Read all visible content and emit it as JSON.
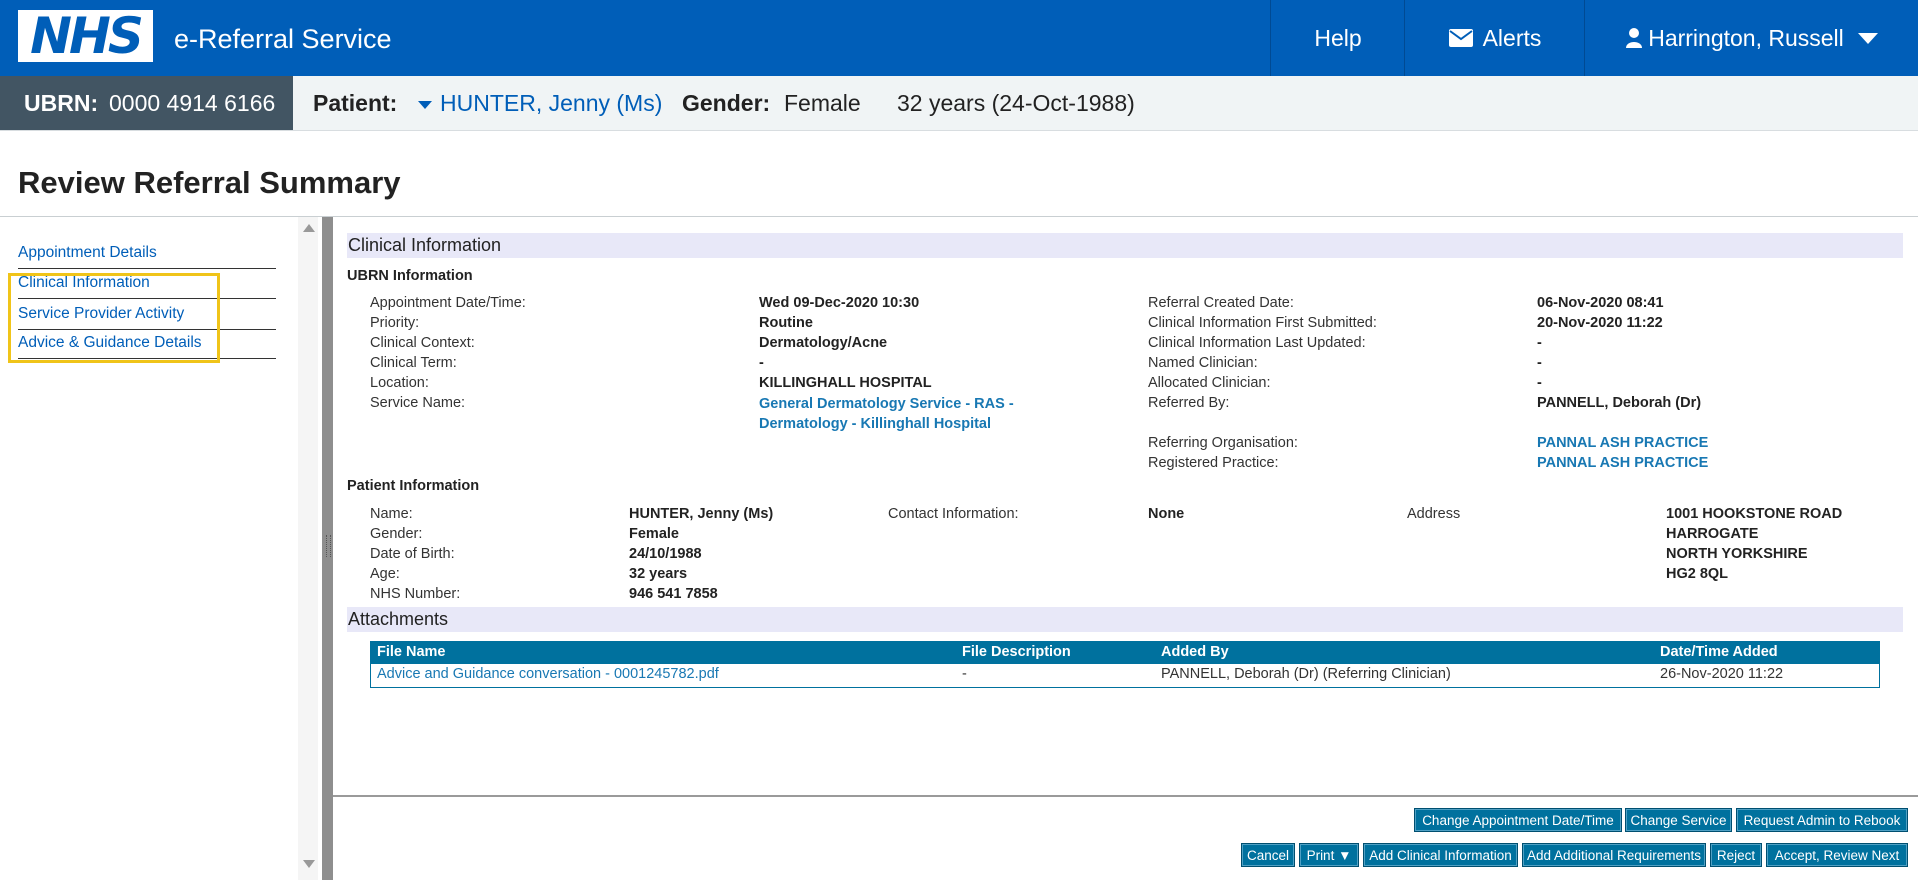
{
  "header": {
    "logo_text": "NHS",
    "app_title": "e-Referral Service",
    "help_label": "Help",
    "alerts_label": "Alerts",
    "user_name": "Harrington, Russell"
  },
  "banner": {
    "ubrn_label": "UBRN:",
    "ubrn_value": "0000 4914 6166",
    "patient_label": "Patient:",
    "patient_name": "HUNTER, Jenny (Ms)",
    "gender_label": "Gender:",
    "gender_value": "Female",
    "age_dob": "32 years (24-Oct-1988)"
  },
  "page_title": "Review Referral Summary",
  "side_menu": [
    "Appointment Details",
    "Clinical Information",
    "Service Provider Activity",
    "Advice & Guidance Details"
  ],
  "clinical": {
    "section_title": "Clinical Information",
    "ubrn_heading": "UBRN Information",
    "left_labels": [
      "Appointment Date/Time:",
      "Priority:",
      "Clinical Context:",
      "Clinical Term:",
      "Location:",
      "Service Name:"
    ],
    "left_values": [
      "Wed 09-Dec-2020 10:30",
      "Routine",
      "Dermatology/Acne",
      "-",
      "KILLINGHALL HOSPITAL"
    ],
    "service_name_line1": "General Dermatology Service - RAS -",
    "service_name_line2": "Dermatology - Killinghall Hospital",
    "right_labels": [
      "Referral Created Date:",
      "Clinical Information First Submitted:",
      "Clinical Information Last Updated:",
      "Named Clinician:",
      "Allocated Clinician:",
      "Referred By:",
      "Referring Organisation:",
      "Registered Practice:"
    ],
    "right_values": [
      "06-Nov-2020 08:41",
      "20-Nov-2020 11:22",
      "-",
      "-",
      "-",
      "PANNELL, Deborah (Dr)",
      "PANNAL ASH PRACTICE",
      "PANNAL ASH PRACTICE"
    ]
  },
  "patient_info": {
    "heading": "Patient Information",
    "labels": [
      "Name:",
      "Gender:",
      "Date of Birth:",
      "Age:",
      "NHS Number:"
    ],
    "values": [
      "HUNTER, Jenny (Ms)",
      "Female",
      "24/10/1988",
      "32 years",
      "946 541 7858"
    ],
    "contact_label": "Contact Information:",
    "contact_value": "None",
    "address_label": "Address",
    "address_lines": [
      "1001 HOOKSTONE ROAD",
      "HARROGATE",
      "NORTH YORKSHIRE",
      "HG2 8QL"
    ]
  },
  "attachments": {
    "section_title": "Attachments",
    "columns": [
      "File Name",
      "File Description",
      "Added By",
      "Date/Time Added"
    ],
    "row": [
      "Advice and Guidance conversation - 0001245782.pdf",
      "-",
      "PANNELL, Deborah (Dr) (Referring Clinician)",
      "26-Nov-2020 11:22"
    ]
  },
  "buttons_row1": [
    "Change Appointment Date/Time",
    "Change Service",
    "Request Admin to Rebook"
  ],
  "buttons_row2": [
    "Cancel",
    "Print ▼",
    "Add Clinical Information",
    "Add Additional Requirements",
    "Reject",
    "Accept, Review Next"
  ],
  "colors": {
    "nhs_blue": "#005eb8",
    "button_blue": "#00719e",
    "highlight": "#f0c419"
  }
}
